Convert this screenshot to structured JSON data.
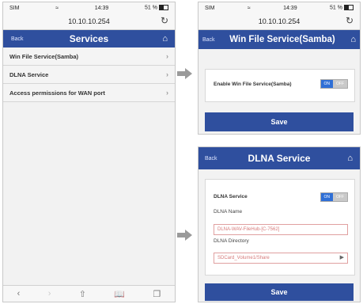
{
  "status": {
    "carrier": "SIM",
    "time": "14:39",
    "battery": "51 %"
  },
  "address": "10.10.10.254",
  "phone1": {
    "back": "Back",
    "title": "Services",
    "items": [
      {
        "label": "Win File Service(Samba)"
      },
      {
        "label": "DLNA Service"
      },
      {
        "label": "Access permissions for WAN port"
      }
    ]
  },
  "phone2": {
    "back": "Back",
    "title": "Win File Service(Samba)",
    "enable_label": "Enable Win File Service(Samba)",
    "toggle_on": "ON",
    "toggle_off": "OFF",
    "save": "Save"
  },
  "phone3": {
    "back": "Back",
    "title": "DLNA Service",
    "service_label": "DLNA Service",
    "toggle_on": "ON",
    "toggle_off": "OFF",
    "name_label": "DLNA Name",
    "name_value": "DLNA-WAV-FileHub-[C-7562]",
    "dir_label": "DLNA Directory",
    "dir_value": "SDCard_Volume1/Share",
    "save": "Save"
  },
  "icons": {
    "home": "home-icon",
    "reload": "reload-icon",
    "chevron": "chevron-right-icon",
    "arrow": "right-arrow-icon"
  },
  "colors": {
    "nav": "#2f4f9e",
    "toggle_on": "#2f6fd6",
    "field_border": "#e0a0a0"
  }
}
